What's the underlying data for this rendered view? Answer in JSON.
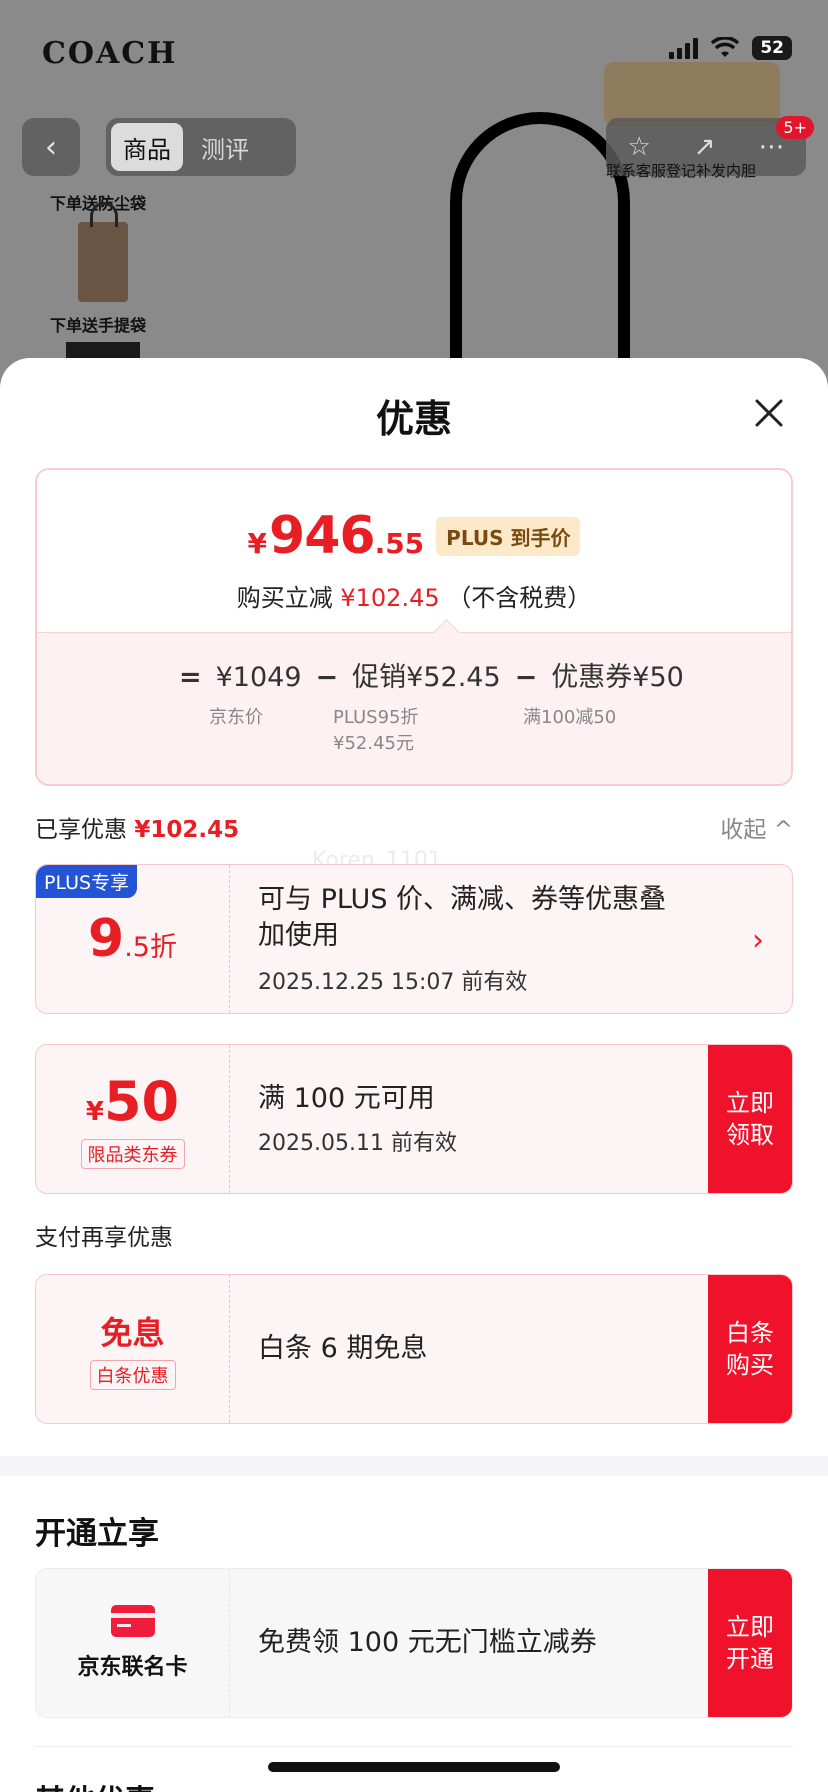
{
  "background": {
    "brand": "COACH",
    "battery": "52",
    "tabs": [
      "商品",
      "测评"
    ],
    "badge": "5+",
    "promo_right": "联系客服登记补发内胆",
    "gift1": "下单送防尘袋",
    "gift2": "下单送手提袋"
  },
  "sheet": {
    "title": "优惠",
    "watermark": "Koren_1101"
  },
  "price": {
    "currency": "¥",
    "final_int": "946",
    "final_dec": ".55",
    "plus_tag": "PLUS 到手价",
    "reduce_prefix": "购买立减",
    "reduce_amount": "¥102.45",
    "reduce_suffix": "（不含税费）",
    "eq": "=",
    "minus": "−",
    "jd_price": "¥1049",
    "jd_price_label": "京东价",
    "promo": "促销¥52.45",
    "promo_sub1": "PLUS95折",
    "promo_sub2": "¥52.45元",
    "coupon": "优惠券¥50",
    "coupon_sub": "满100减50"
  },
  "enjoyed": {
    "label": "已享优惠",
    "amount": "¥102.45",
    "collapse": "收起 ^"
  },
  "cards": {
    "plus": {
      "tag": "PLUS专享",
      "value_int": "9",
      "value_rest": ".5折",
      "desc": "可与 PLUS 价、满减、券等优惠叠加使用",
      "valid": "2025.12.25 15:07 前有效",
      "arrow": "›"
    },
    "coupon": {
      "currency": "¥",
      "value": "50",
      "tag": "限品类东券",
      "desc": "满 100 元可用",
      "valid": "2025.05.11 前有效",
      "button": "立即领取"
    },
    "pay_label": "支付再享优惠",
    "baitiao": {
      "title": "免息",
      "tag": "白条优惠",
      "desc": "白条 6 期免息",
      "button": "白条购买"
    }
  },
  "open": {
    "title": "开通立享",
    "card_label": "京东联名卡",
    "desc": "免费领 100 元无门槛立减券",
    "button": "立即开通",
    "next_section": "其他优惠"
  },
  "colors": {
    "accent_red": "#e81e25",
    "button_red": "#f0112a",
    "plus_blue": "#2454d6"
  }
}
